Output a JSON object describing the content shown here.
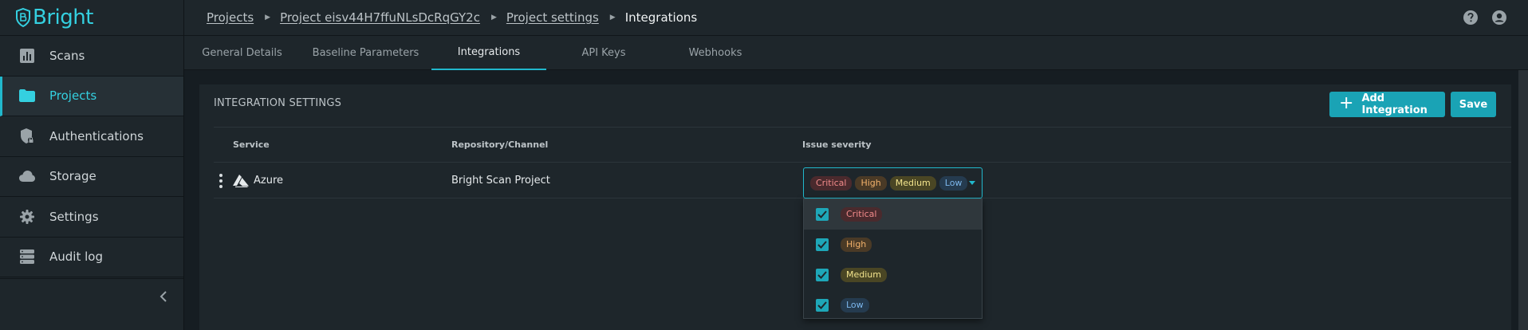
{
  "app": {
    "name": "Bright"
  },
  "sidebar": {
    "items": [
      {
        "label": "Scans",
        "icon": "bar-chart-icon"
      },
      {
        "label": "Projects",
        "icon": "folder-icon",
        "active": true
      },
      {
        "label": "Authentications",
        "icon": "shield-lock-icon"
      },
      {
        "label": "Storage",
        "icon": "cloud-icon"
      },
      {
        "label": "Settings",
        "icon": "gear-icon"
      },
      {
        "label": "Audit log",
        "icon": "database-icon"
      }
    ]
  },
  "breadcrumb": {
    "items": [
      "Projects",
      "Project eisv44H7ffuNLsDcRqGY2c",
      "Project settings"
    ],
    "current": "Integrations"
  },
  "tabs": [
    {
      "label": "General Details"
    },
    {
      "label": "Baseline Parameters"
    },
    {
      "label": "Integrations",
      "active": true
    },
    {
      "label": "API Keys"
    },
    {
      "label": "Webhooks"
    }
  ],
  "card": {
    "title": "INTEGRATION SETTINGS",
    "add_label": "Add Integration",
    "save_label": "Save"
  },
  "table": {
    "columns": [
      "Service",
      "Repository/Channel",
      "Issue severity"
    ],
    "rows": [
      {
        "service": "Azure",
        "repository": "Bright Scan Project",
        "severities": [
          "Critical",
          "High",
          "Medium",
          "Low"
        ]
      }
    ]
  },
  "severity_options": [
    {
      "label": "Critical",
      "checked": true
    },
    {
      "label": "High",
      "checked": true
    },
    {
      "label": "Medium",
      "checked": true
    },
    {
      "label": "Low",
      "checked": true
    }
  ],
  "colors": {
    "accent": "#21b8cc",
    "button": "#1aa3b5",
    "critical": "#f28a8a",
    "high": "#f2b16b",
    "medium": "#f3e48d",
    "low": "#7cb7ec"
  }
}
